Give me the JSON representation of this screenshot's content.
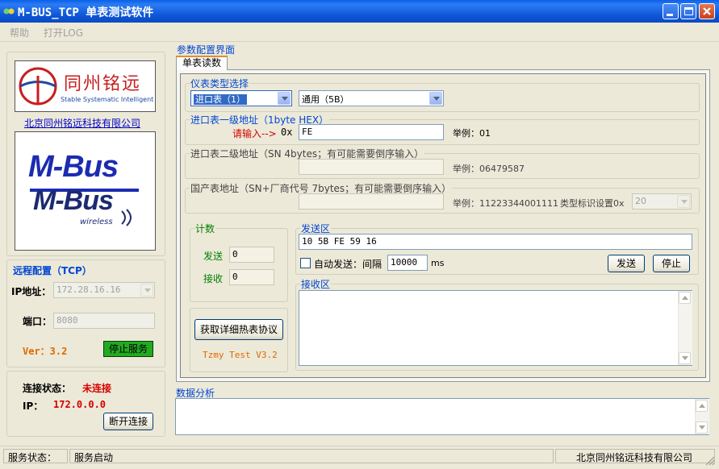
{
  "window": {
    "title": "M-BUS_TCP 单表测试软件"
  },
  "menu": {
    "help": "帮助",
    "open_log": "打开LOG"
  },
  "left": {
    "logo_cn": "同州铭远",
    "logo_en": "Stable Systematic Intelligent",
    "company_link": "北京同州铭远科技有限公司",
    "mbus_top": "M-Bus",
    "mbus_bottom": "M-Bus",
    "mbus_wireless": "wireless",
    "remote_config_title": "远程配置（TCP）",
    "ip_label": "IP地址：",
    "ip_value": "172.28.16.16",
    "port_label": "端口：",
    "port_value": "8080",
    "version": "Ver：3.2",
    "stop_service_button": "停止服务",
    "conn_status_label": "连接状态：",
    "conn_status_value": "未连接",
    "ip2_label": "IP：",
    "ip2_value": "172.0.0.0",
    "disconnect_button": "断开连接"
  },
  "main": {
    "section_title": "参数配置界面",
    "tab": "单表读数",
    "meter_type_title": "仪表类型选择",
    "meter_type_value": "进口表（1）",
    "protocol_value": "通用（5B）",
    "import_addr1_title": "进口表一级地址（1byte HEX）",
    "please_input": "请输入-->",
    "hex_prefix": "0x",
    "addr1_value": "FE",
    "addr1_example": "举例：01",
    "import_addr2_title": "进口表二级地址（SN 4bytes；有可能需要倒序输入）",
    "addr2_value": "",
    "addr2_example": "举例：06479587",
    "domestic_addr_title": "国产表地址（SN+厂商代号 7bytes；有可能需要倒序输入）",
    "domestic_value": "",
    "domestic_example": "举例：11223344001111",
    "type_id_label": "类型标识设置0x",
    "type_id_value": "20",
    "count_title": "计数",
    "send_label": "发送",
    "send_count": "0",
    "recv_label": "接收",
    "recv_count": "0",
    "get_protocol_button": "获取详细热表协议",
    "tzmy_version": "Tzmy Test V3.2",
    "send_area_title": "发送区",
    "send_data": "10 5B FE 59 16",
    "auto_send_label": "自动发送：间隔",
    "interval_value": "10000",
    "ms_label": "ms",
    "send_button": "发送",
    "stop_button": "停止",
    "recv_area_title": "接收区",
    "recv_data": ""
  },
  "analysis": {
    "title": "数据分析",
    "content": ""
  },
  "status": {
    "label": "服务状态：",
    "value": "服务启动",
    "company": "北京同州铭远科技有限公司"
  },
  "colors": {
    "title_bar": "#0a5fe8",
    "group_label": "#0046d5",
    "red": "#d40000",
    "green": "#008000",
    "orange": "#e06800",
    "led_green": "#22aa22"
  }
}
